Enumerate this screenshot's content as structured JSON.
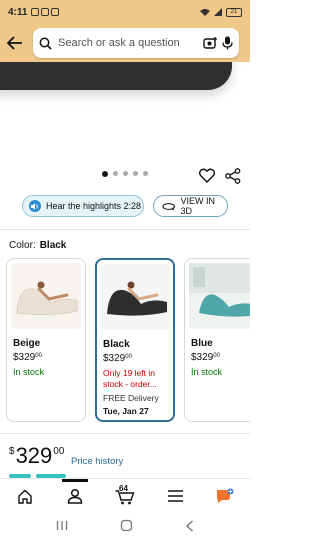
{
  "status": {
    "time": "4:11",
    "battery": "21"
  },
  "search": {
    "placeholder": "Search or ask a question"
  },
  "gallery": {
    "dot_count": 5,
    "active_index": 0
  },
  "highlights": {
    "label": "Hear the highlights 2:28"
  },
  "view3d": {
    "label": "VIEW IN 3D"
  },
  "color": {
    "label": "Color:",
    "selected": "Black"
  },
  "variants": [
    {
      "name": "Beige",
      "price_whole": "$329",
      "price_cents": "00",
      "stock": "In stock"
    },
    {
      "name": "Black",
      "price_whole": "$329",
      "price_cents": "00",
      "stock": "Only 19 left in stock - order...",
      "delivery": "FREE Delivery",
      "date": "Tue, Jan 27"
    },
    {
      "name": "Blue",
      "price_whole": "$329",
      "price_cents": "00",
      "stock": "In stock"
    }
  ],
  "price": {
    "currency": "$",
    "whole": "329",
    "cents": "00",
    "history_label": "Price history"
  },
  "nav": {
    "cart_count": "64"
  },
  "colors": {
    "header_bg": "#f0c98a",
    "selected_border": "#2f6f96",
    "in_stock": "#007600",
    "low_stock": "#c40000",
    "accent_teal": "#39c1c1"
  }
}
